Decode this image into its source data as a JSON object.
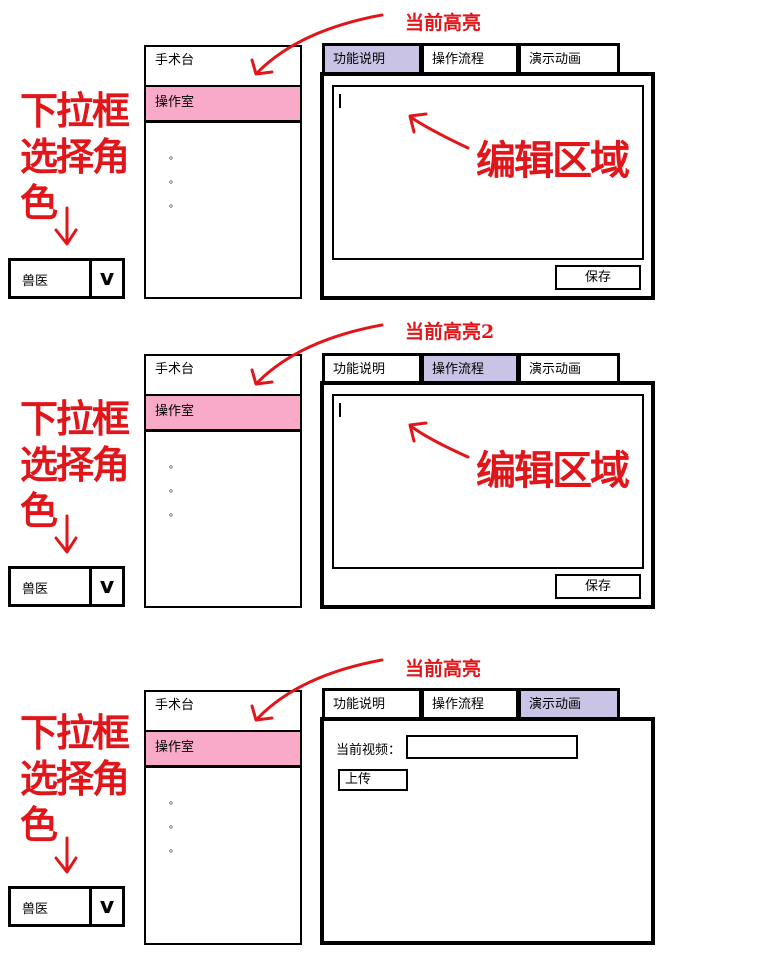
{
  "annotations": {
    "dropdown_note": "下拉框选择角色",
    "edit_area": "编辑区域",
    "highlight": "当前高亮",
    "highlight_2": "当前高亮2"
  },
  "dropdown": {
    "value": "兽医"
  },
  "list": {
    "items": [
      "手术台",
      "操作室"
    ],
    "selected": "操作室",
    "ellipsis": [
      "。",
      "。",
      "。"
    ]
  },
  "tabs": [
    "功能说明",
    "操作流程",
    "演示动画"
  ],
  "panels": [
    {
      "active_tab": 0,
      "save_label": "保存"
    },
    {
      "active_tab": 1,
      "save_label": "保存"
    },
    {
      "active_tab": 2,
      "video_label": "当前视频：",
      "upload_label": "上传"
    }
  ],
  "colors": {
    "selected_item": "#f9aac8",
    "active_tab": "#c9c3e6",
    "annotation_red": "#e0161b"
  }
}
